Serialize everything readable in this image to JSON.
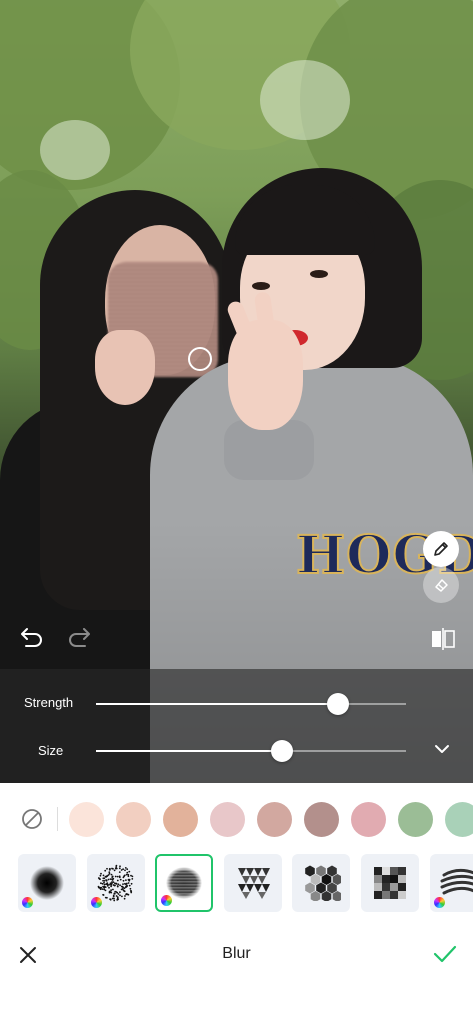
{
  "editor": {
    "title": "Blur",
    "photo_overlay_text": "HOGD"
  },
  "sliders": [
    {
      "label": "Strength",
      "value": 0.78
    },
    {
      "label": "Size",
      "value": 0.6
    }
  ],
  "colors": {
    "accent": "#20c46a",
    "swatches": [
      "#fbe4da",
      "#f2cfc1",
      "#e2b29b",
      "#e8c7c9",
      "#d2a8a0",
      "#b3908c",
      "#e1abb1",
      "#9bbd96",
      "#a9d1b8"
    ]
  },
  "brushes": [
    {
      "name": "soft-blur-brush",
      "has_color": true,
      "selected": false
    },
    {
      "name": "spray-brush",
      "has_color": true,
      "selected": false
    },
    {
      "name": "mosaic-blur-brush",
      "has_color": true,
      "selected": true
    },
    {
      "name": "triangle-mosaic-brush",
      "has_color": false,
      "selected": false
    },
    {
      "name": "hexagon-mosaic-brush",
      "has_color": false,
      "selected": false
    },
    {
      "name": "square-mosaic-brush",
      "has_color": false,
      "selected": false
    },
    {
      "name": "scribble-brush",
      "has_color": true,
      "selected": false
    }
  ],
  "icons": {
    "undo": "undo-icon",
    "redo": "redo-icon",
    "compare": "compare-icon",
    "pen": "pen-icon",
    "eraser": "eraser-icon",
    "collapse": "chevron-down-icon",
    "none": "none-icon",
    "close": "close-icon",
    "confirm": "check-icon"
  }
}
